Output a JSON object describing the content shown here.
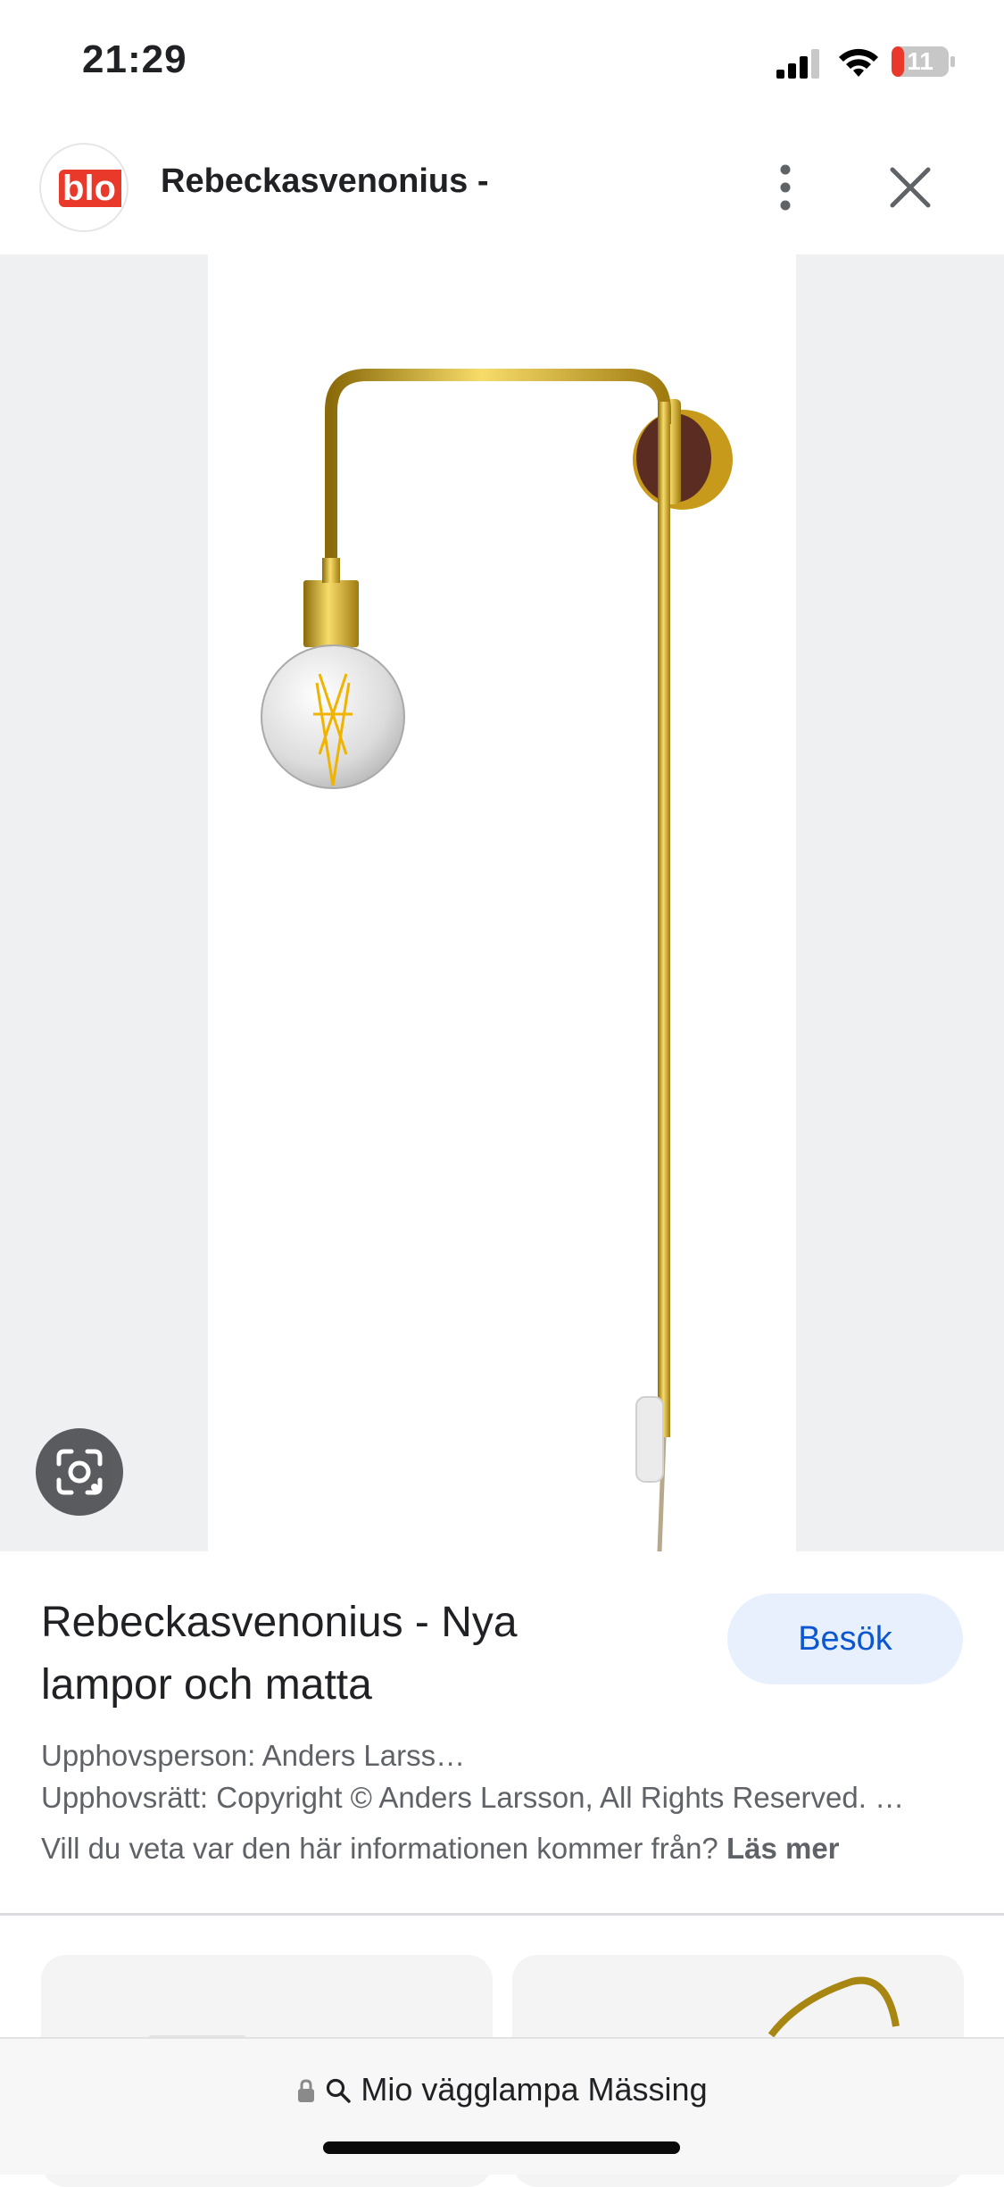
{
  "status_bar": {
    "time": "21:29",
    "battery_level": "11"
  },
  "header": {
    "site_title": "Rebeckasvenonius -",
    "logo_text": "blo"
  },
  "result": {
    "title": "Rebeckasvenonius - Nya lampor och matta",
    "visit_label": "Besök",
    "creator": "Upphovsperson: Anders Larss…",
    "copyright": "Upphovsrätt: Copyright © Anders Larsson, All Rights Reserved. …",
    "source_question": "Vill du veta var den här informationen kommer från?",
    "learn_more": "Läs mer"
  },
  "url_bar": {
    "text": "Mio vägglampa Mässing"
  },
  "icons": [
    "signal-icon",
    "wifi-icon",
    "battery-icon",
    "more-vert-icon",
    "close-icon",
    "lens-icon",
    "lock-icon",
    "search-icon"
  ],
  "colors": {
    "accent": "#0b57d0",
    "visit_bg": "#e8f0fe",
    "brass": "#d4a81c",
    "logo_red": "#e8392b"
  }
}
